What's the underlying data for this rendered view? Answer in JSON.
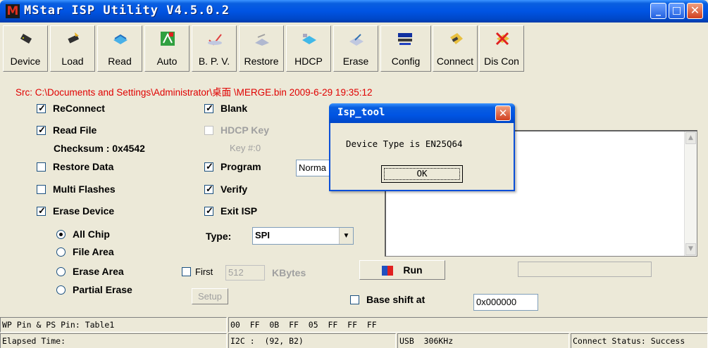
{
  "window": {
    "title": "MStar ISP Utility V4.5.0.2",
    "logo": "M"
  },
  "toolbar": [
    {
      "label": "Device",
      "icon": "device-chip-icon"
    },
    {
      "label": "Load",
      "icon": "load-chip-icon"
    },
    {
      "label": "Read",
      "icon": "read-arrow-icon"
    },
    {
      "label": "Auto",
      "icon": "auto-icon"
    },
    {
      "label": "B. P. V.",
      "icon": "bpv-check-icon"
    },
    {
      "label": "Restore",
      "icon": "restore-icon"
    },
    {
      "label": "HDCP",
      "icon": "hdcp-icon"
    },
    {
      "label": "Erase",
      "icon": "erase-icon"
    },
    {
      "label": "Config",
      "icon": "config-icon"
    },
    {
      "label": "Connect",
      "icon": "connect-icon"
    },
    {
      "label": "Dis Con",
      "icon": "disconnect-icon"
    }
  ],
  "src_line": "Src: C:\\Documents and Settings\\Administrator\\桌面 \\MERGE.bin 2009-6-29 19:35:12",
  "options": {
    "reconnect": "ReConnect",
    "read_file": "Read File",
    "checksum": "Checksum : 0x4542",
    "restore_data": "Restore Data",
    "multi_flashes": "Multi Flashes",
    "erase_device": "Erase Device",
    "blank": "Blank",
    "hdcp_key": "HDCP Key",
    "key_num": "Key #:0",
    "program": "Program",
    "program_mode": "Norma",
    "verify": "Verify",
    "exit_isp": "Exit ISP",
    "type_label": "Type:",
    "type_value": "SPI"
  },
  "erase": {
    "all_chip": "All Chip",
    "file_area": "File Area",
    "erase_area": "Erase Area",
    "partial_erase": "Partial Erase",
    "first_label": "First",
    "first_value": "512",
    "kbytes": "KBytes",
    "setup": "Setup"
  },
  "run_label": "Run",
  "base_shift": {
    "label": "Base shift at",
    "value": "0x000000"
  },
  "status": {
    "wp_pin": "WP Pin & PS Pin: Table1",
    "hex_bytes": "00  FF  0B  FF  05  FF  FF  FF",
    "elapsed": "Elapsed Time:",
    "i2c": "I2C :  (92, B2)",
    "usb": "USB  306KHz",
    "connect_status": "Connect Status: Success"
  },
  "dialog": {
    "title": "Isp_tool",
    "message": "Device Type is EN25Q64",
    "ok": "OK"
  },
  "colors": {
    "titlebar": "#0054e3",
    "src_text": "#e00000",
    "face": "#ece9d8"
  }
}
